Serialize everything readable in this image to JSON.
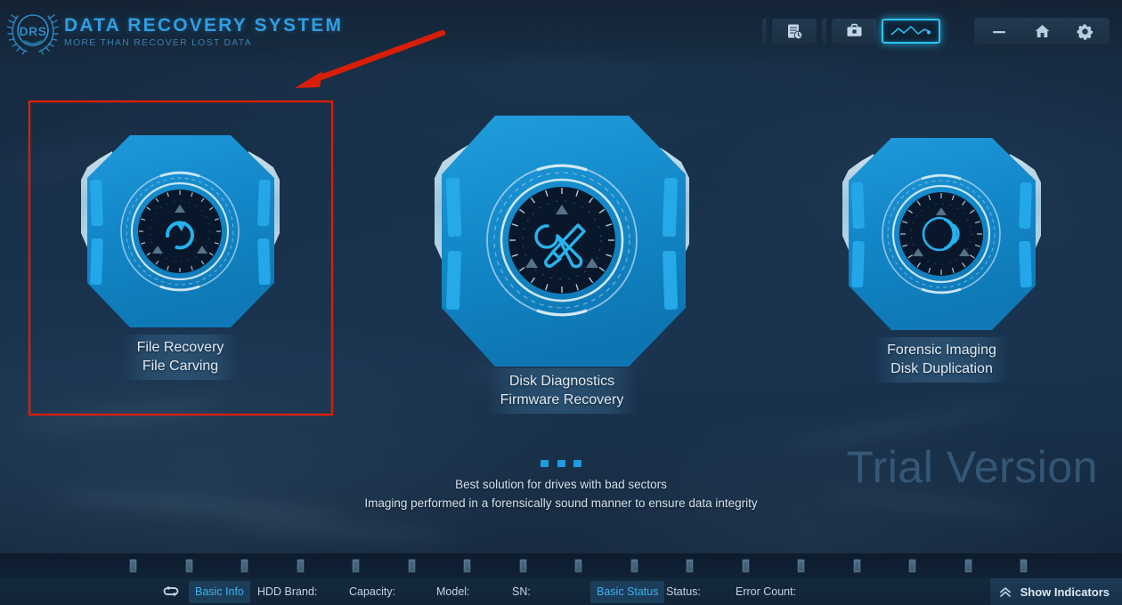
{
  "app": {
    "logo_icon": "drs-laurel-emblem",
    "title": "DATA RECOVERY SYSTEM",
    "subtitle": "MORE THAN RECOVER LOST DATA"
  },
  "toolbar": {
    "buttons": [
      {
        "name": "report-icon",
        "label": "Report",
        "active": false
      },
      {
        "name": "toolbox-icon",
        "label": "Toolbox",
        "active": false
      },
      {
        "name": "graph-monitor-icon",
        "label": "Monitor",
        "active": true
      }
    ],
    "window_buttons": [
      {
        "name": "minimize-icon",
        "label": "Minimize"
      },
      {
        "name": "home-icon",
        "label": "Home"
      },
      {
        "name": "settings-gear-icon",
        "label": "Settings"
      }
    ]
  },
  "tiles": [
    {
      "id": "file-recovery",
      "icon": "refresh-circle-icon",
      "line1": "File Recovery",
      "line2": "File Carving",
      "selected": true
    },
    {
      "id": "disk-diagnostics",
      "icon": "wrench-screwdriver-icon",
      "line1": "Disk Diagnostics",
      "line2": "Firmware Recovery",
      "selected": false
    },
    {
      "id": "forensic-imaging",
      "icon": "concentric-arcs-icon",
      "line1": "Forensic Imaging",
      "line2": "Disk Duplication",
      "selected": false
    }
  ],
  "tagline": {
    "line1": "Best solution for drives with bad sectors",
    "line2": "Imaging performed in a forensically sound manner to ensure data integrity"
  },
  "watermark": "Trial Version",
  "statusbar": {
    "sync_icon": "sync-loop-icon",
    "fields": [
      {
        "label": "Basic Info",
        "highlight": true
      },
      {
        "label": "HDD Brand:",
        "highlight": false
      },
      {
        "label": "Capacity:",
        "highlight": false
      },
      {
        "label": "Model:",
        "highlight": false
      },
      {
        "label": "SN:",
        "highlight": false
      },
      {
        "label": "Basic Status",
        "highlight": true
      },
      {
        "label": "Status:",
        "highlight": false
      },
      {
        "label": "Error Count:",
        "highlight": false
      }
    ],
    "show_indicators": {
      "label": "Show Indicators",
      "icon": "chevron-up-double-icon"
    }
  },
  "indicator_count": 17,
  "annotation": {
    "color": "#d81f06",
    "arrow": "points to selected File Recovery tile",
    "box": "highlights File Recovery / File Carving tile"
  },
  "colors": {
    "accent_cyan": "#2bc4f7",
    "brand_blue": "#2e9fe0",
    "hex_blue": "#1287c8",
    "bg_navy": "#17304a",
    "annotation_red": "#d81f06",
    "highlight_text": "#3cb3ee"
  }
}
